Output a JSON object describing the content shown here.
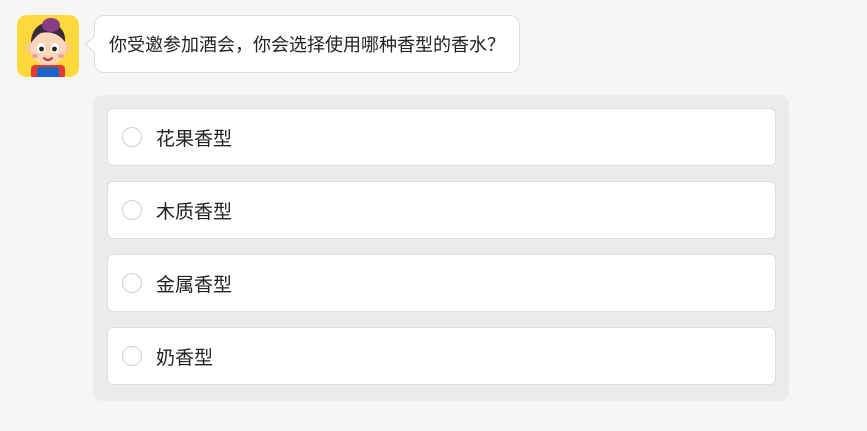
{
  "question": {
    "avatar_icon": "cartoon-boy-avatar",
    "text": "你受邀参加酒会，你会选择使用哪种香型的香水？"
  },
  "options": [
    {
      "label": "花果香型",
      "selected": false
    },
    {
      "label": "木质香型",
      "selected": false
    },
    {
      "label": "金属香型",
      "selected": false
    },
    {
      "label": "奶香型",
      "selected": false
    }
  ],
  "colors": {
    "page_background": "#f6f6f6",
    "panel_background": "#ebebeb",
    "avatar_background": "#ffd93b"
  }
}
